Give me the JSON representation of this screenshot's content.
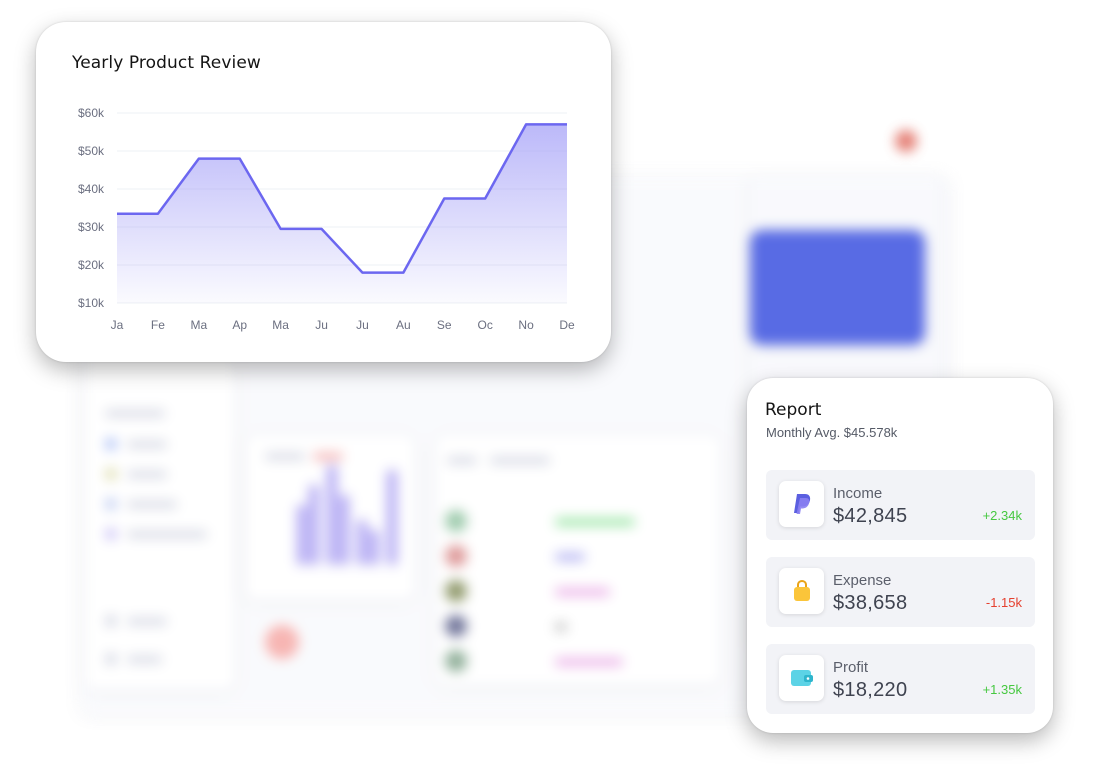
{
  "chart_card": {
    "title": "Yearly Product Review"
  },
  "chart_data": {
    "type": "area",
    "title": "Yearly Product Review",
    "categories": [
      "Ja",
      "Fe",
      "Ma",
      "Ap",
      "Ma",
      "Ju",
      "Ju",
      "Au",
      "Se",
      "Oc",
      "No",
      "De"
    ],
    "values": [
      33500,
      33500,
      48000,
      48000,
      29500,
      29500,
      18000,
      18000,
      37500,
      37500,
      57000,
      57000
    ],
    "yticks": [
      "$60k",
      "$50k",
      "$40k",
      "$30k",
      "$20k",
      "$10k"
    ],
    "ytick_values": [
      60000,
      50000,
      40000,
      30000,
      20000,
      10000
    ],
    "ylim": [
      10000,
      60000
    ],
    "grid": true,
    "line_color": "#6c67f0",
    "fill_color": "#a5a1f7"
  },
  "report": {
    "title": "Report",
    "subtitle": "Monthly Avg. $45.578k",
    "items": [
      {
        "label": "Income",
        "value": "$42,845",
        "change": "+2.34k",
        "trend": "up",
        "icon": "paypal-icon"
      },
      {
        "label": "Expense",
        "value": "$38,658",
        "change": "-1.15k",
        "trend": "down",
        "icon": "shopping-bag-icon"
      },
      {
        "label": "Profit",
        "value": "$18,220",
        "change": "+1.35k",
        "trend": "up",
        "icon": "wallet-icon"
      }
    ]
  },
  "colors": {
    "positive": "#46c840",
    "negative": "#e5402f",
    "accent": "#6c67f0"
  }
}
